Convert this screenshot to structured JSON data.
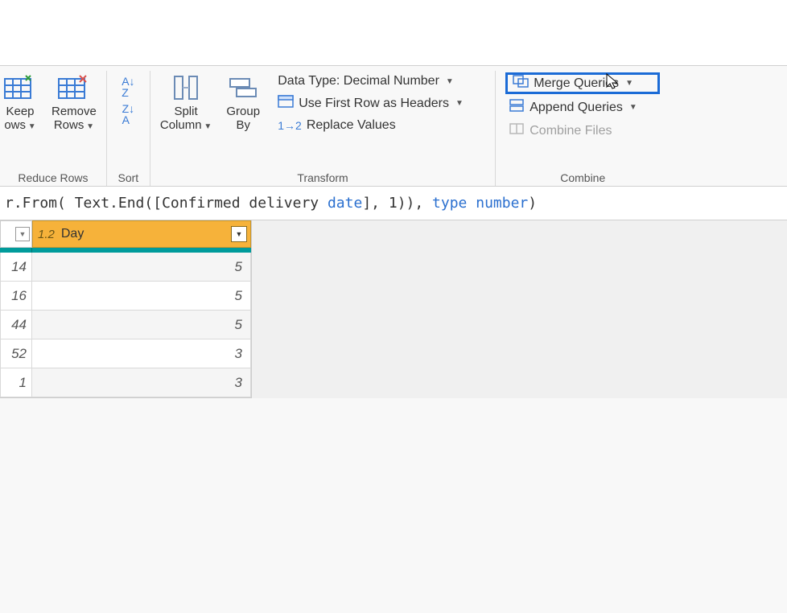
{
  "ribbon": {
    "reduce_rows": {
      "label": "Reduce Rows",
      "keep_rows": "Keep",
      "keep_rows2": "ows",
      "remove_rows": "Remove",
      "remove_rows2": "Rows"
    },
    "sort": {
      "label": "Sort"
    },
    "transform": {
      "label": "Transform",
      "split_column": "Split",
      "split_column2": "Column",
      "group_by": "Group",
      "group_by2": "By",
      "data_type": "Data Type: Decimal Number",
      "use_first_row": "Use First Row as Headers",
      "replace_values": "Replace Values"
    },
    "combine": {
      "label": "Combine",
      "merge": "Merge Queries",
      "append": "Append Queries",
      "combine_files": "Combine Files"
    }
  },
  "formula": {
    "p1": "r.From( Text.End([Confirmed delivery ",
    "p2": "date",
    "p3": "], ",
    "p4": "1",
    "p5": ")), ",
    "p6": "type number",
    "p7": ")"
  },
  "grid": {
    "col2_typetag": "1.2",
    "col2_name": "Day",
    "rows": [
      {
        "c1": "14",
        "c2": "5"
      },
      {
        "c1": "16",
        "c2": "5"
      },
      {
        "c1": "44",
        "c2": "5"
      },
      {
        "c1": "52",
        "c2": "3"
      },
      {
        "c1": "1",
        "c2": "3"
      }
    ]
  }
}
